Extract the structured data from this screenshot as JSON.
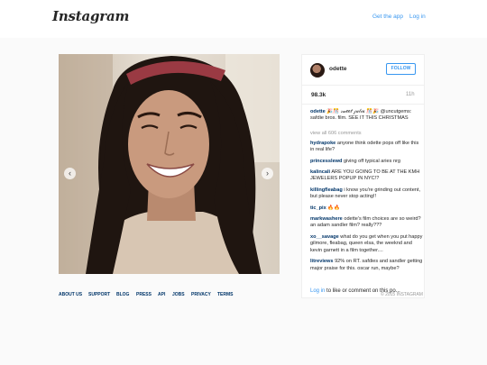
{
  "topbar": {
    "logo": "Instagram",
    "get_app": "Get the app",
    "login": "Log in"
  },
  "post": {
    "username": "odette",
    "follow_label": "FOLLOW",
    "likes": "98.3k",
    "age": "11h",
    "caption_user": "odette",
    "caption_text": "🎉🎊 𝓈𝓌𝑒𝑒𝓉 𝒿𝓊𝓁𝒾𝒶 🎊🎉 @uncutgems: safdie bros. film. SEE IT THIS CHRISTMAS",
    "view_all": "view all 606 comments",
    "comments": [
      {
        "user": "hydrapoke",
        "text": "anyone think odette pops off like this in real life?"
      },
      {
        "user": "princesslewd",
        "text": "giving off typical aries nrg"
      },
      {
        "user": "kalincali",
        "text": "ARE YOU GOING TO BE AT THE KMH JEWELERS POPUP IN NYC!?"
      },
      {
        "user": "killingfleabag",
        "text": "i know you're grinding out content, but please never stop acting!!"
      },
      {
        "user": "tic_pix",
        "text": "🔥🔥"
      },
      {
        "user": "markwashere",
        "text": "odette's film choices are so weird? an adam sandler film? really???"
      },
      {
        "user": "xo__savage",
        "text": "what do you get when you put happy gilmore, fleabag, queen elsa, the weeknd and kevin garnett in a film together...."
      },
      {
        "user": "litreviews",
        "text": "92% on RT. safdies and sandler getting major praise for this. oscar run, maybe?"
      }
    ],
    "login_link": "Log in",
    "login_suffix": "to like or comment on this po..."
  },
  "carousel": {
    "prev_icon": "chevron-left-icon",
    "next_icon": "chevron-right-icon"
  },
  "footer": {
    "links": [
      "ABOUT US",
      "SUPPORT",
      "BLOG",
      "PRESS",
      "API",
      "JOBS",
      "PRIVACY",
      "TERMS"
    ],
    "copyright": "© 2015 INSTAGRAM"
  },
  "colors": {
    "accent": "#3897f0",
    "username_link": "#003569",
    "background": "#fafafa"
  }
}
